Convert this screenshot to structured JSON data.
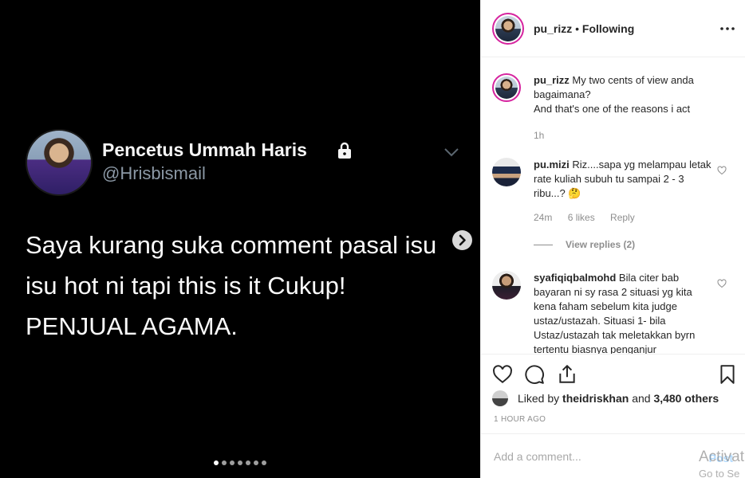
{
  "media": {
    "tweet": {
      "display_name": "Pencetus Ummah Haris",
      "handle": "@Hrisbismail",
      "text_lines": [
        "Saya kurang suka comment pasal isu",
        "isu hot ni tapi this is it Cukup!",
        "PENJUAL AGAMA."
      ]
    },
    "carousel": {
      "total": 7,
      "active_index": 0
    }
  },
  "post": {
    "username": "pu_rizz",
    "separator": "•",
    "follow_status": "Following",
    "caption": {
      "username": "pu_rizz",
      "text_line1": "My two cents of view anda bagaimana?",
      "text_line2": "And that's one of the reasons i act",
      "age": "1h"
    },
    "comments": [
      {
        "username": "pu.mizi",
        "text": "Riz....sapa yg melampau letak rate kuliah subuh tu sampai 2 - 3 ribu...? 🤔",
        "age": "24m",
        "likes": "6 likes",
        "reply": "Reply",
        "view_replies": "View replies (2)"
      },
      {
        "username": "syafiqiqbalmohd",
        "text": "Bila citer bab bayaran ni sy rasa 2 situasi yg kita kena faham sebelum kita judge ustaz/ustazah. Situasi 1- bila Ustaz/ustazah tak meletakkan byrn tertentu biasnya penganjur"
      }
    ],
    "liked_by_prefix": "Liked by",
    "liked_by_user": "theidriskhan",
    "liked_by_and": "and",
    "liked_by_others": "3,480 others",
    "time_ago": "1 HOUR AGO",
    "comment_placeholder": "Add a comment...",
    "post_label": "Post"
  },
  "watermark": {
    "line1": "Activat",
    "line2": "Go to Se"
  },
  "colors": {
    "accent": "#0095f6",
    "story_ring": "#d6249f",
    "muted": "#8e8e8e"
  }
}
